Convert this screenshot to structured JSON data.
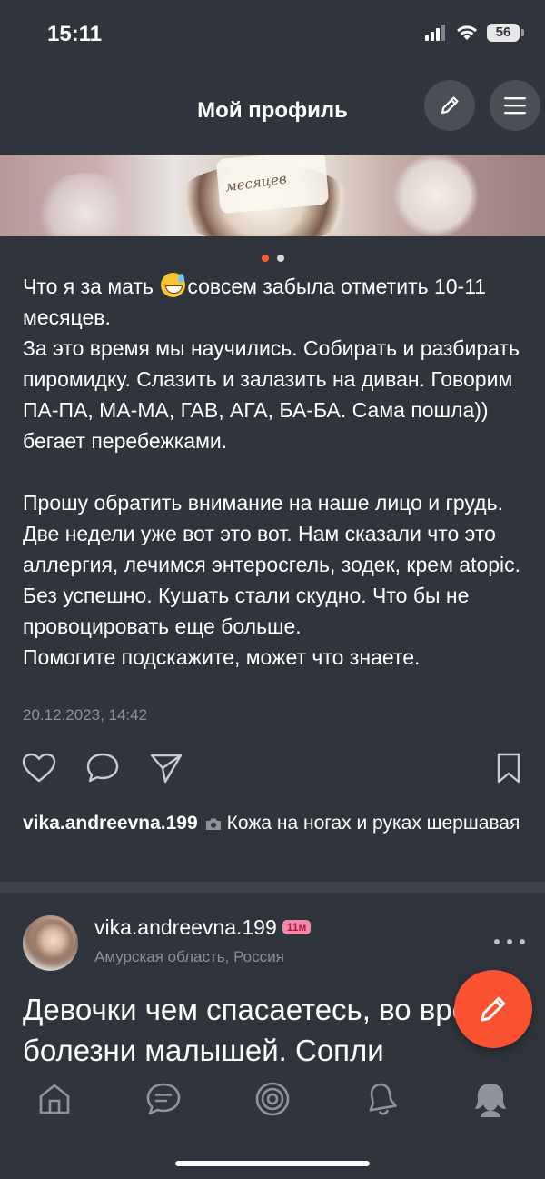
{
  "status_bar": {
    "time": "15:11",
    "battery": "56"
  },
  "header": {
    "title": "Мой профиль"
  },
  "photo": {
    "caption": "месяцев"
  },
  "carousel": {
    "count": 2,
    "active": 0
  },
  "post": {
    "paragraph1_before_emoji": "Что я за мать",
    "paragraph1_after_emoji": "совсем забыла отметить 10-11 месяцев.",
    "paragraph1_rest": "За это время мы научились. Собирать и разбирать пиромидку. Слазить и залазить на диван. Говорим ПА-ПА,  МА-МА, ГАВ, АГА, БА-БА. Сама пошла)) бегает перебежками.",
    "paragraph2": "Прошу обратить внимание на наше лицо и грудь. Две недели уже вот это вот. Нам сказали что это аллергия, лечимся энтеросгель, зодек, крем atopic.",
    "paragraph3": "Без успешно. Кушать стали скудно. Что бы не провоцировать еще больше.",
    "paragraph4": "Помогите подскажите, может что знаете.",
    "date": "20.12.2023, 14:42"
  },
  "comment_preview": {
    "user": "vika.andreevna.199",
    "text": "Кожа на ногах и руках шершавая"
  },
  "next_post": {
    "user": "vika.andreevna.199",
    "badge": "11м",
    "location": "Амурская область, Россия",
    "text": "Девочки чем спасаетесь, во время болезни малышей. Сопли"
  },
  "colors": {
    "accent": "#fa5230",
    "background": "#30353d",
    "muted": "#8b9099"
  },
  "icons": {
    "actions": [
      "heart-icon",
      "comment-icon",
      "share-icon",
      "bookmark-icon"
    ],
    "tabbar": [
      "home-icon",
      "chat-icon",
      "target-icon",
      "bell-icon",
      "profile-icon"
    ]
  }
}
